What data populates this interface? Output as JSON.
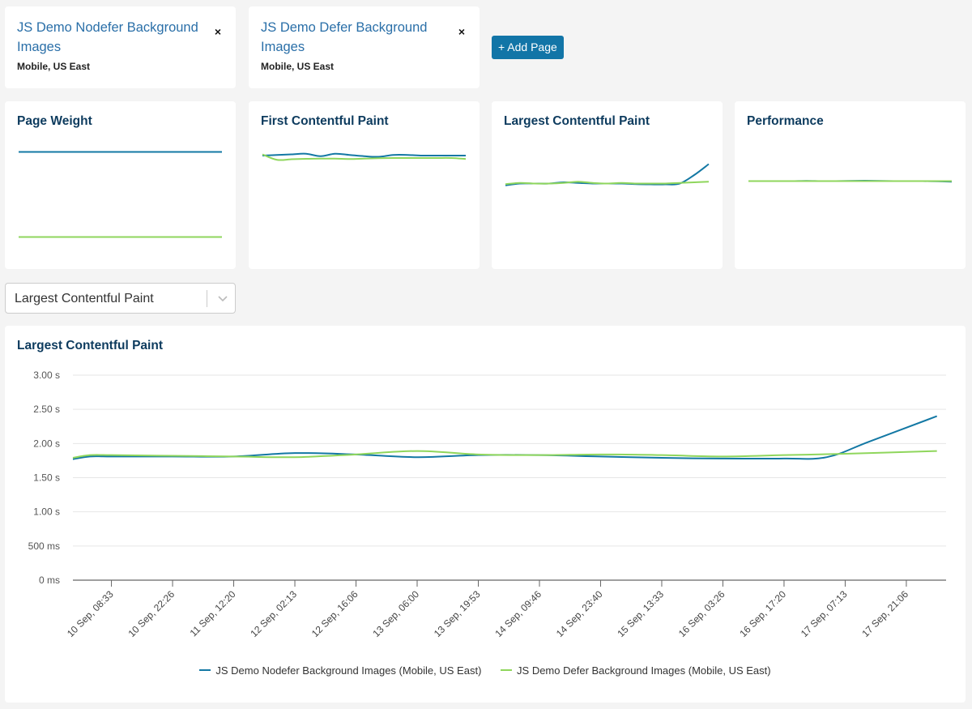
{
  "colors": {
    "series_a": "#1378a4",
    "series_b": "#8fd65c",
    "accent": "#1275a7",
    "title": "#0d3b5e"
  },
  "pages": [
    {
      "title": "JS Demo Nodefer Background Images",
      "subtitle": "Mobile, US East",
      "close_icon": "×"
    },
    {
      "title": "JS Demo Defer Background Images",
      "subtitle": "Mobile, US East",
      "close_icon": "×"
    }
  ],
  "add_page_label": "+ Add Page",
  "metrics": [
    {
      "title": "Page Weight",
      "a": [
        0.85,
        0.85,
        0.85,
        0.85,
        0.85,
        0.85,
        0.85,
        0.85,
        0.85,
        0.85,
        0.85,
        0.85,
        0.85,
        0.85,
        0.85
      ],
      "b": [
        0.15,
        0.15,
        0.15,
        0.15,
        0.15,
        0.15,
        0.15,
        0.15,
        0.15,
        0.15,
        0.15,
        0.15,
        0.15,
        0.15,
        0.15
      ]
    },
    {
      "title": "First Contentful Paint",
      "a": [
        0.82,
        0.825,
        0.83,
        0.835,
        0.815,
        0.835,
        0.825,
        0.815,
        0.81,
        0.825,
        0.825,
        0.82,
        0.82,
        0.82,
        0.82
      ],
      "b": [
        0.83,
        0.785,
        0.79,
        0.793,
        0.795,
        0.795,
        0.792,
        0.795,
        0.798,
        0.8,
        0.8,
        0.8,
        0.8,
        0.8,
        0.792
      ]
    },
    {
      "title": "Largest Contentful Paint",
      "a": [
        0.575,
        0.59,
        0.59,
        0.59,
        0.6,
        0.595,
        0.59,
        0.59,
        0.59,
        0.585,
        0.583,
        0.583,
        0.59,
        0.66,
        0.75
      ],
      "b": [
        0.585,
        0.595,
        0.59,
        0.59,
        0.595,
        0.605,
        0.595,
        0.59,
        0.595,
        0.59,
        0.59,
        0.59,
        0.595,
        0.6,
        0.605
      ]
    },
    {
      "title": "Performance",
      "a": [
        0.61,
        0.61,
        0.61,
        0.61,
        0.612,
        0.61,
        0.61,
        0.612,
        0.613,
        0.612,
        0.61,
        0.61,
        0.61,
        0.608,
        0.605
      ],
      "b": [
        0.61,
        0.61,
        0.61,
        0.61,
        0.61,
        0.61,
        0.61,
        0.61,
        0.61,
        0.61,
        0.61,
        0.61,
        0.61,
        0.61,
        0.61
      ]
    }
  ],
  "metric_select": {
    "value": "Largest Contentful Paint",
    "arrow_icon": "chevron-down"
  },
  "chart_data": {
    "type": "line",
    "title": "Largest Contentful Paint",
    "xlabel": "",
    "ylabel": "",
    "ylim": [
      0,
      3.0
    ],
    "y_ticks": [
      {
        "value": 0,
        "label": "0 ms"
      },
      {
        "value": 0.5,
        "label": "500 ms"
      },
      {
        "value": 1.0,
        "label": "1.00 s"
      },
      {
        "value": 1.5,
        "label": "1.50 s"
      },
      {
        "value": 2.0,
        "label": "2.00 s"
      },
      {
        "value": 2.5,
        "label": "2.50 s"
      },
      {
        "value": 3.0,
        "label": "3.00 s"
      }
    ],
    "x_ticks": [
      "10 Sep, 08:33",
      "10 Sep, 22:26",
      "11 Sep, 12:20",
      "12 Sep, 02:13",
      "12 Sep, 16:06",
      "13 Sep, 06:00",
      "13 Sep, 19:53",
      "14 Sep, 09:46",
      "14 Sep, 23:40",
      "15 Sep, 13:33",
      "16 Sep, 03:26",
      "16 Sep, 17:20",
      "17 Sep, 07:13",
      "17 Sep, 21:06"
    ],
    "x_range": [
      -0.63,
      13.65
    ],
    "x_data_range": [
      -0.63,
      13.5
    ],
    "grid": true,
    "legend_position": "bottom",
    "series": [
      {
        "name": "JS Demo Nodefer Background Images (Mobile, US East)",
        "color": "#1378a4",
        "x": [
          -0.63,
          -0.35,
          0,
          1,
          2,
          3,
          4,
          5,
          6,
          7,
          8,
          9,
          10,
          11,
          11.7,
          12.4,
          13.5
        ],
        "values": [
          1.77,
          1.81,
          1.81,
          1.81,
          1.81,
          1.86,
          1.84,
          1.8,
          1.83,
          1.83,
          1.81,
          1.79,
          1.78,
          1.78,
          1.8,
          2.03,
          2.4
        ]
      },
      {
        "name": "JS Demo Defer Background Images (Mobile, US East)",
        "color": "#8fd65c",
        "x": [
          -0.63,
          -0.35,
          0,
          1,
          2,
          3,
          4,
          5,
          6,
          7,
          8,
          9,
          10,
          11,
          12,
          13.5
        ],
        "values": [
          1.79,
          1.83,
          1.83,
          1.82,
          1.81,
          1.8,
          1.84,
          1.89,
          1.84,
          1.83,
          1.84,
          1.83,
          1.81,
          1.83,
          1.85,
          1.89
        ]
      }
    ]
  }
}
